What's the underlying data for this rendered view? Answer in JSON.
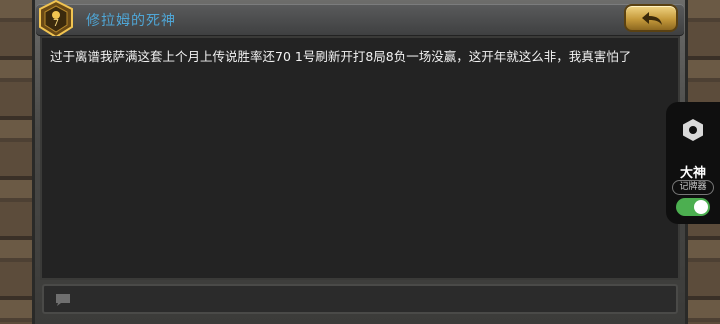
{
  "header": {
    "title": "修拉姆的死神",
    "rank_badge": {
      "icon": "rank-shield-icon",
      "level": "7"
    },
    "back_button": {
      "icon": "back-arrow-icon"
    }
  },
  "message": {
    "text": "过于离谱我萨满这套上个月上传说胜率还70 1号刷新开打8局8负一场没赢，这开年就这么非，我真害怕了"
  },
  "input": {
    "icon": "chat-bubble-icon"
  },
  "side_panel": {
    "icon": "hexagon-settings-icon",
    "label_main": "大神",
    "label_sub": "记牌器",
    "toggle_on": true,
    "toggle_color": "#4caf50"
  }
}
